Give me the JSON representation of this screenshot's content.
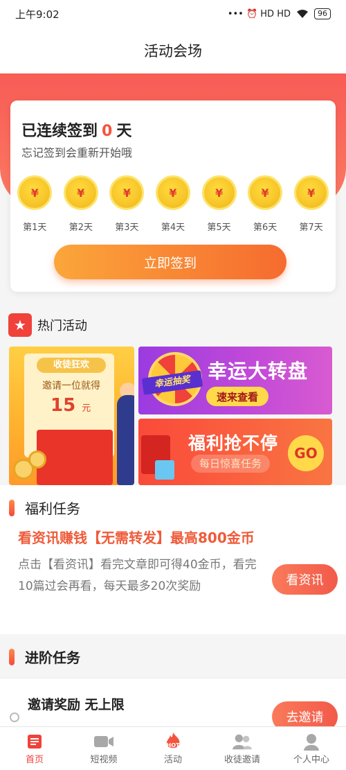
{
  "status_bar": {
    "time": "上午9:02",
    "signal_icons": "••• ⏰ HD HD",
    "battery": "96"
  },
  "header": {
    "title": "活动会场"
  },
  "signin": {
    "prefix": "已连续签到",
    "days": "0",
    "suffix": "天",
    "subtitle": "忘记签到会重新开始哦",
    "coin_symbol": "¥",
    "day_labels": [
      "第1天",
      "第2天",
      "第3天",
      "第4天",
      "第5天",
      "第6天",
      "第7天"
    ],
    "button_label": "立即签到",
    "accent_color": "#f5533d"
  },
  "hot": {
    "title": "热门活动",
    "invite_banner": {
      "tag": "收徒狂欢",
      "line": "邀请一位就得",
      "amount": "15",
      "unit": "元"
    },
    "wheel_banner": {
      "ribbon": "幸运抽奖",
      "title": "幸运大转盘",
      "button": "速来查看"
    },
    "welfare_banner": {
      "title": "福利抢不停",
      "subtitle": "每日惊喜任务",
      "go": "GO"
    }
  },
  "welfare_tasks": {
    "section_title": "福利任务",
    "headline": "看资讯赚钱【无需转发】最高800金币",
    "description": "点击【看资讯】看完文章即可得40金币，看完10篇过会再看，每天最多20次奖励",
    "button": "看资讯"
  },
  "advanced_tasks": {
    "section_title": "进阶任务",
    "item_title": "邀请奖励 无上限",
    "button": "去邀请"
  },
  "tabbar": {
    "items": [
      {
        "label": "首页",
        "icon": "home-icon",
        "active": true
      },
      {
        "label": "短视频",
        "icon": "video-icon",
        "active": false
      },
      {
        "label": "活动",
        "icon": "hot-activity-icon",
        "active": false
      },
      {
        "label": "收徒邀请",
        "icon": "users-icon",
        "active": false
      },
      {
        "label": "个人中心",
        "icon": "profile-icon",
        "active": false
      }
    ]
  }
}
